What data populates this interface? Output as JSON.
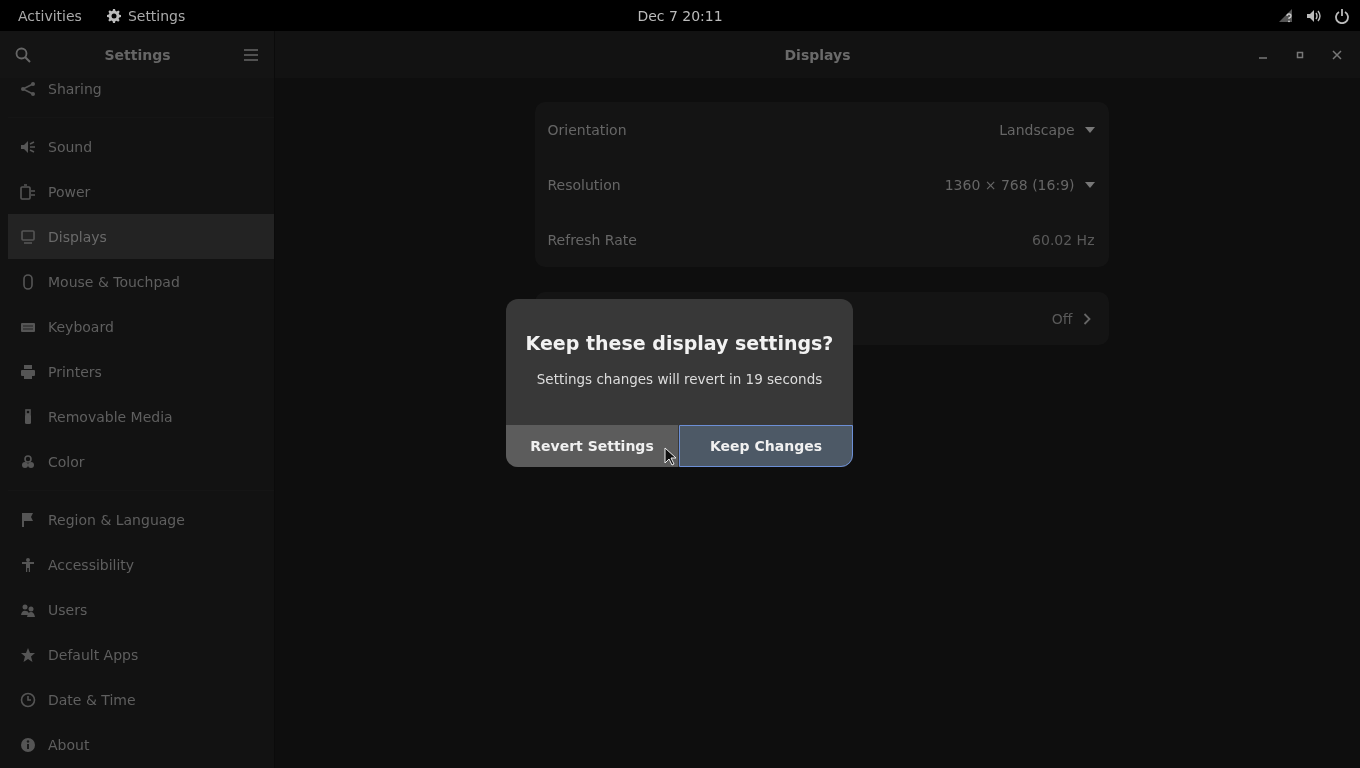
{
  "top_bar": {
    "activities": "Activities",
    "app_name": "Settings",
    "clock": "Dec 7  20:11"
  },
  "header": {
    "sidebar_title": "Settings",
    "page_title": "Displays"
  },
  "sidebar": {
    "groups": [
      [
        {
          "label": "Sharing",
          "selected": false
        }
      ],
      [
        {
          "label": "Sound",
          "selected": false
        },
        {
          "label": "Power",
          "selected": false
        },
        {
          "label": "Displays",
          "selected": true
        },
        {
          "label": "Mouse & Touchpad",
          "selected": false
        },
        {
          "label": "Keyboard",
          "selected": false
        },
        {
          "label": "Printers",
          "selected": false
        },
        {
          "label": "Removable Media",
          "selected": false
        },
        {
          "label": "Color",
          "selected": false
        }
      ],
      [
        {
          "label": "Region & Language",
          "selected": false
        },
        {
          "label": "Accessibility",
          "selected": false
        },
        {
          "label": "Users",
          "selected": false
        },
        {
          "label": "Default Apps",
          "selected": false
        },
        {
          "label": "Date & Time",
          "selected": false
        },
        {
          "label": "About",
          "selected": false
        }
      ]
    ]
  },
  "display_settings": {
    "rows": [
      {
        "kind": "dropdown",
        "label": "Orientation",
        "value": "Landscape"
      },
      {
        "kind": "dropdown",
        "label": "Resolution",
        "value": "1360 × 768 (16:9)"
      },
      {
        "kind": "plain",
        "label": "Refresh Rate",
        "value": "60.02 Hz"
      }
    ]
  },
  "night_light_row": {
    "value": "Off"
  },
  "dialog": {
    "title": "Keep these display settings?",
    "message": "Settings changes will revert in 19 seconds",
    "buttons": [
      {
        "label": "Revert Settings",
        "kind": "normal"
      },
      {
        "label": "Keep Changes",
        "kind": "suggested"
      }
    ]
  }
}
